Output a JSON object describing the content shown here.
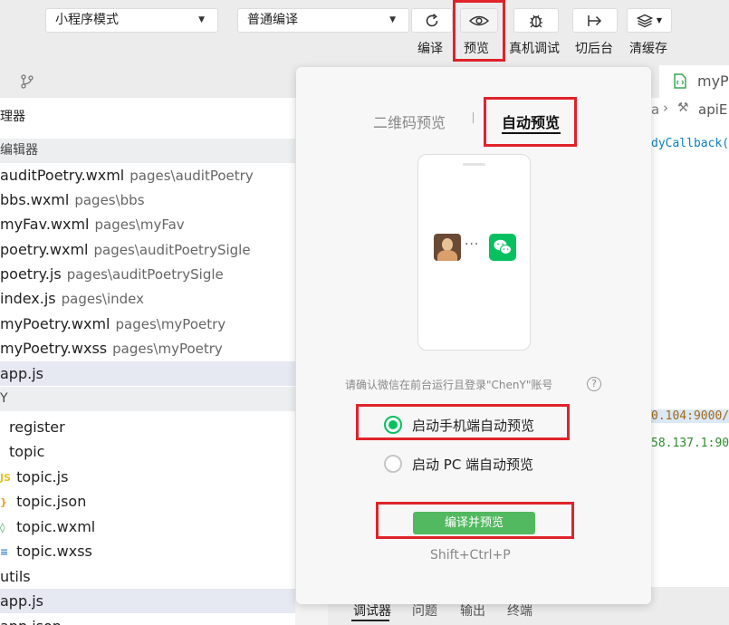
{
  "toolbar": {
    "mode_select": "小程序模式",
    "compile_select": "普通编译",
    "buttons": [
      {
        "label": "编译",
        "icon": "refresh-icon"
      },
      {
        "label": "预览",
        "icon": "eye-icon"
      },
      {
        "label": "真机调试",
        "icon": "bug-icon"
      },
      {
        "label": "切后台",
        "icon": "arrow-right-bar-icon"
      },
      {
        "label": "清缓存",
        "icon": "layers-icon"
      }
    ]
  },
  "tabs": {
    "open_file": "myPo"
  },
  "explorer": {
    "title": "理器",
    "section_open": "编辑器",
    "open_files": [
      {
        "name": "auditPoetry.wxml",
        "path": "pages\\auditPoetry"
      },
      {
        "name": "bbs.wxml",
        "path": "pages\\bbs"
      },
      {
        "name": "myFav.wxml",
        "path": "pages\\myFav"
      },
      {
        "name": "poetry.wxml",
        "path": "pages\\auditPoetrySigle"
      },
      {
        "name": "poetry.js",
        "path": "pages\\auditPoetrySigle"
      },
      {
        "name": "index.js",
        "path": "pages\\index"
      },
      {
        "name": "myPoetry.wxml",
        "path": "pages\\myPoetry"
      },
      {
        "name": "myPoetry.wxss",
        "path": "pages\\myPoetry"
      },
      {
        "name": "app.js",
        "path": ""
      }
    ],
    "section_project": "Y",
    "tree": [
      {
        "name": "register",
        "icon": "folder-icon"
      },
      {
        "name": "topic",
        "icon": "folder-icon"
      },
      {
        "name": "topic.js",
        "icon": "js-file-icon"
      },
      {
        "name": "topic.json",
        "icon": "json-file-icon"
      },
      {
        "name": "topic.wxml",
        "icon": "wxml-file-icon"
      },
      {
        "name": "topic.wxss",
        "icon": "wxss-file-icon"
      },
      {
        "name": "utils",
        "icon": "folder-icon"
      },
      {
        "name": "app.js",
        "icon": "js-file-icon"
      },
      {
        "name": "app.json",
        "icon": "json-file-icon"
      }
    ]
  },
  "editor": {
    "breadcrumb_a": "a",
    "breadcrumb_b": "apiE",
    "code_line1": "dyCallback(",
    "code_line2": "0.104:9000/",
    "code_line3": "58.137.1:90"
  },
  "preview_popover": {
    "tab_qr": "二维码预览",
    "tab_auto": "自动预览",
    "confirm_text": "请确认微信在前台运行且登录\"ChenY\"账号",
    "help_icon": "?",
    "options": [
      {
        "label": "启动手机端自动预览",
        "selected": true
      },
      {
        "label": "启动 PC 端自动预览",
        "selected": false
      }
    ],
    "compile_button": "编译并预览",
    "shortcut": "Shift+Ctrl+P",
    "dots": "···"
  },
  "bottom_tabs": [
    "调试器",
    "问题",
    "输出",
    "终端"
  ],
  "colors": {
    "accent_green": "#07c160",
    "button_green": "#52b960",
    "highlight_red": "#e0232a"
  }
}
